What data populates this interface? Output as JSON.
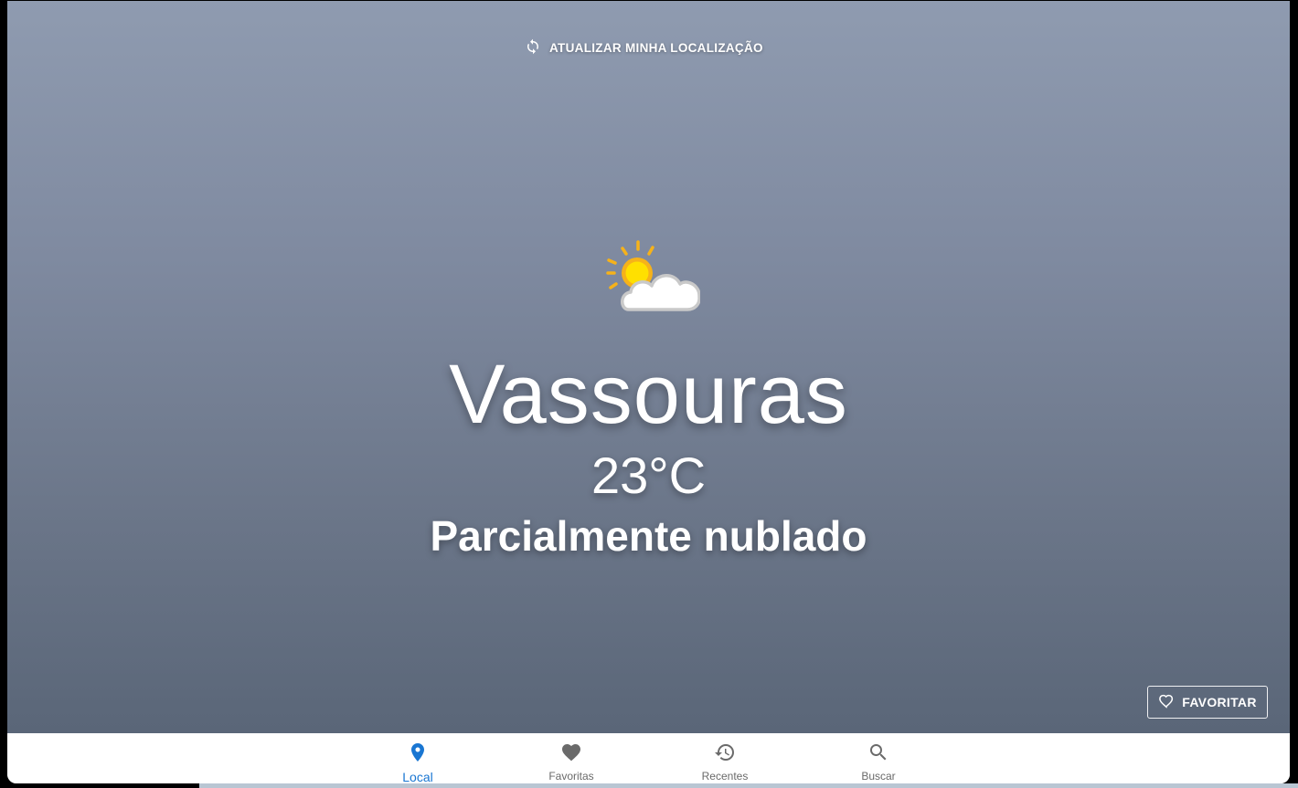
{
  "header": {
    "refresh_label": "ATUALIZAR MINHA LOCALIZAÇÃO",
    "refresh_icon": "sync-icon"
  },
  "weather": {
    "icon": "partly-cloudy-icon",
    "city": "Vassouras",
    "temperature": "23°C",
    "condition": "Parcialmente nublado"
  },
  "actions": {
    "favorite_label": "FAVORITAR",
    "favorite_icon": "heart-outline-icon"
  },
  "bottom_nav": {
    "items": [
      {
        "label": "Local",
        "icon": "location-pin-icon",
        "active": true
      },
      {
        "label": "Favoritas",
        "icon": "heart-icon",
        "active": false
      },
      {
        "label": "Recentes",
        "icon": "history-icon",
        "active": false
      },
      {
        "label": "Buscar",
        "icon": "search-icon",
        "active": false
      }
    ]
  },
  "colors": {
    "accent": "#1976d2",
    "inactive": "#6a6a6a",
    "hero_top": "#8f9bb0",
    "hero_bottom": "#5a6678"
  }
}
